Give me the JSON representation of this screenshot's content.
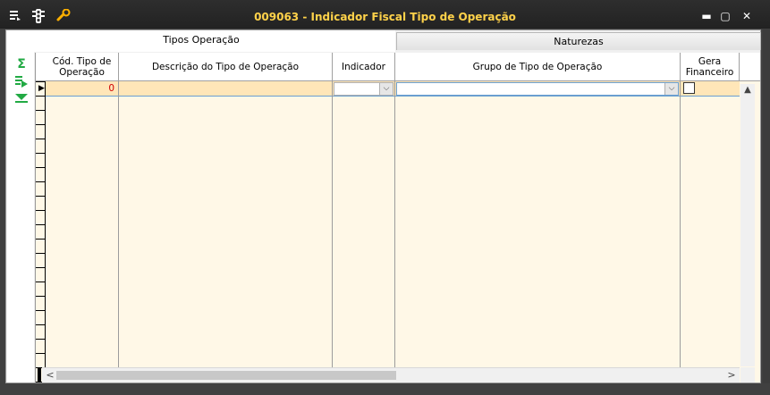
{
  "window": {
    "title": "009063 - Indicador Fiscal Tipo de Operação",
    "icons": [
      "menu-icon",
      "traffic-light-icon",
      "wrench-icon"
    ],
    "controls": {
      "minimize": "▬",
      "maximize": "▢",
      "close": "✕"
    }
  },
  "tabs": [
    {
      "label": "Tipos Operação",
      "active": true
    },
    {
      "label": "Naturezas",
      "active": false
    }
  ],
  "left_toolbar": {
    "sum_glyph": "Σ",
    "export_glyph": "⇛",
    "filter_glyph": "⏬"
  },
  "grid": {
    "columns": [
      {
        "header": "Cód. Tipo de Operação"
      },
      {
        "header": "Descrição do Tipo de Operação"
      },
      {
        "header": "Indicador"
      },
      {
        "header": "Grupo de Tipo de Operação"
      },
      {
        "header": "Gera Financeiro"
      }
    ],
    "rows": [
      {
        "cod": "0",
        "descricao": "",
        "indicador": "",
        "grupo": "",
        "gera_financeiro": false
      }
    ],
    "dropdown_glyph": "⌵"
  },
  "scroll": {
    "up": "▲",
    "down": "▼",
    "left": "<",
    "right": ">"
  },
  "colors": {
    "title": "#ffd24a",
    "row_selected": "#ffe6b8",
    "grid_bg": "#fff8e7",
    "code_value": "#d00000"
  }
}
